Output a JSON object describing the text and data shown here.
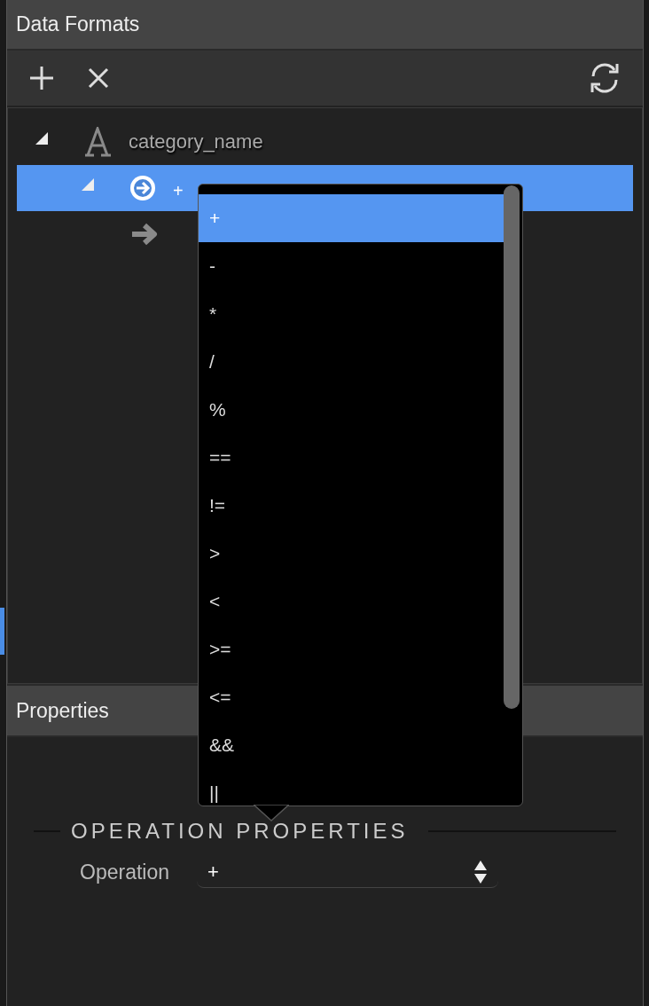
{
  "panel": {
    "title": "Data Formats"
  },
  "toolbar": {
    "buttons": [
      {
        "kind": "add"
      },
      {
        "kind": "remove"
      },
      {
        "kind": "refresh"
      }
    ]
  },
  "tree": [
    {
      "label": "category_name",
      "kind": "text",
      "expanded": true,
      "selected": false,
      "children": [
        {
          "label": "+",
          "kind": "operation",
          "expanded": true,
          "selected": true,
          "children": [
            {
              "kind": "argument",
              "selected": false
            }
          ]
        }
      ]
    }
  ],
  "dropdown": {
    "options": [
      {
        "label": "+",
        "selected": true
      },
      {
        "label": "-",
        "selected": false
      },
      {
        "label": "*",
        "selected": false
      },
      {
        "label": "/",
        "selected": false
      },
      {
        "label": "%",
        "selected": false
      },
      {
        "label": "==",
        "selected": false
      },
      {
        "label": "!=",
        "selected": false
      },
      {
        "label": ">",
        "selected": false
      },
      {
        "label": "<",
        "selected": false
      },
      {
        "label": ">=",
        "selected": false
      },
      {
        "label": "<=",
        "selected": false
      },
      {
        "label": "&&",
        "selected": false
      },
      {
        "label": "||",
        "selected": false
      }
    ]
  },
  "properties": {
    "title": "Properties",
    "section": "OPERATION PROPERTIES",
    "fields": [
      {
        "label": "Operation",
        "value": "+"
      }
    ]
  }
}
